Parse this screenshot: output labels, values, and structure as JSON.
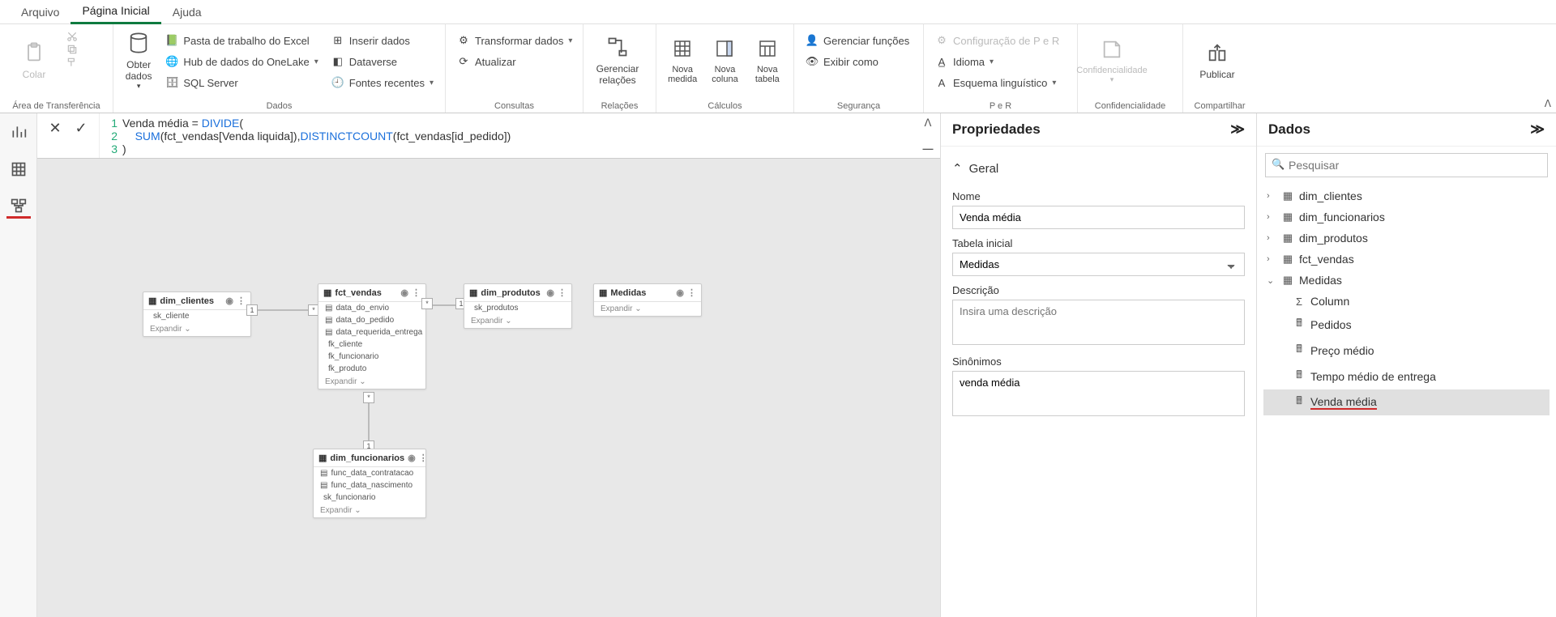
{
  "menu": {
    "arquivo": "Arquivo",
    "inicio": "Página Inicial",
    "ajuda": "Ajuda"
  },
  "ribbon": {
    "clipboard": {
      "label": "Área de Transferência",
      "paste": "Colar"
    },
    "data": {
      "label": "Dados",
      "getdata": "Obter\ndados",
      "excel": "Pasta de trabalho do Excel",
      "onelake": "Hub de dados do OneLake",
      "sql": "SQL Server",
      "insert": "Inserir dados",
      "dataverse": "Dataverse",
      "recent": "Fontes recentes"
    },
    "queries": {
      "label": "Consultas",
      "transform": "Transformar dados",
      "refresh": "Atualizar"
    },
    "relations": {
      "label": "Relações",
      "manage": "Gerenciar\nrelações"
    },
    "calc": {
      "label": "Cálculos",
      "measure": "Nova\nmedida",
      "column": "Nova\ncoluna",
      "table": "Nova\ntabela"
    },
    "security": {
      "label": "Segurança",
      "roles": "Gerenciar funções",
      "viewas": "Exibir como"
    },
    "qa": {
      "label": "P e R",
      "config": "Configuração de P e R",
      "lang": "Idioma",
      "ling": "Esquema linguístico"
    },
    "sens": {
      "label": "Confidencialidade",
      "btn": "Confidencialidade"
    },
    "share": {
      "label": "Compartilhar",
      "publish": "Publicar"
    }
  },
  "formula": {
    "line1_a": "Venda média = ",
    "line1_b": "DIVIDE",
    "line1_c": "(",
    "line2_a": "    ",
    "line2_b": "SUM",
    "line2_c": "(fct_vendas[Venda liquida]),",
    "line2_d": "DISTINCTCOUNT",
    "line2_e": "(fct_vendas[id_pedido])",
    "line3": ")"
  },
  "model": {
    "dim_clientes": {
      "title": "dim_clientes",
      "c1": "sk_cliente",
      "expand": "Expandir"
    },
    "fct_vendas": {
      "title": "fct_vendas",
      "c1": "data_do_envio",
      "c2": "data_do_pedido",
      "c3": "data_requerida_entrega",
      "c4": "fk_cliente",
      "c5": "fk_funcionario",
      "c6": "fk_produto",
      "expand": "Expandir"
    },
    "dim_produtos": {
      "title": "dim_produtos",
      "c1": "sk_produtos",
      "expand": "Expandir"
    },
    "medidas": {
      "title": "Medidas",
      "expand": "Expandir"
    },
    "dim_funcionarios": {
      "title": "dim_funcionarios",
      "c1": "func_data_contratacao",
      "c2": "func_data_nascimento",
      "c3": "sk_funcionario",
      "expand": "Expandir"
    }
  },
  "props": {
    "title": "Propriedades",
    "general": "Geral",
    "name_label": "Nome",
    "name_value": "Venda média",
    "hometable_label": "Tabela inicial",
    "hometable_value": "Medidas",
    "desc_label": "Descrição",
    "desc_placeholder": "Insira uma descrição",
    "syn_label": "Sinônimos",
    "syn_value": "venda média"
  },
  "datapanel": {
    "title": "Dados",
    "search_placeholder": "Pesquisar",
    "t1": "dim_clientes",
    "t2": "dim_funcionarios",
    "t3": "dim_produtos",
    "t4": "fct_vendas",
    "t5": "Medidas",
    "m1": "Column",
    "m2": "Pedidos",
    "m3": "Preço médio",
    "m4": "Tempo médio de entrega",
    "m5": "Venda média"
  }
}
